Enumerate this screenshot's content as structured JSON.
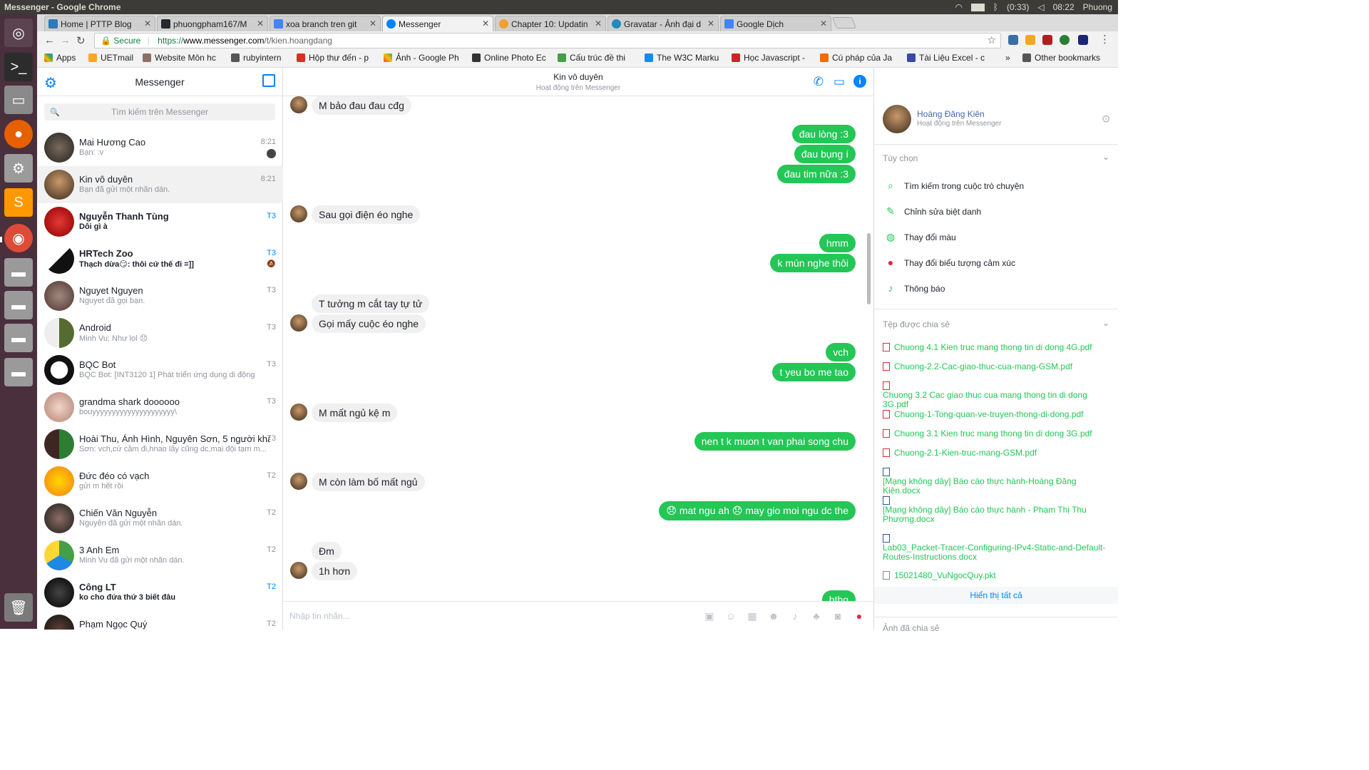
{
  "os": {
    "window_title": "Messenger - Google Chrome",
    "keyboard": "En",
    "battery": "(0:33)",
    "clock": "08:22",
    "user": "Phuong"
  },
  "browser": {
    "tabs": [
      {
        "title": "Home | PTTP Blog",
        "color": "#2b7bb9"
      },
      {
        "title": "phuongpham167/M",
        "color": "#24292e"
      },
      {
        "title": "xoa branch tren git",
        "color": "#4285f4"
      },
      {
        "title": "Messenger",
        "color": "#0084ff"
      },
      {
        "title": "Chapter 10: Updatin",
        "color": "#f0a030"
      },
      {
        "title": "Gravatar - Ảnh đại d",
        "color": "#1e8cbe"
      },
      {
        "title": "Google Dịch",
        "color": "#4285f4"
      }
    ],
    "secure_label": "Secure",
    "url_scheme": "https://",
    "url_host": "www.messenger.com",
    "url_path": "/t/kien.hoangdang",
    "bookmarks": [
      "Apps",
      "UETmail",
      "Website Môn hc",
      "rubyintern",
      "Hộp thư đến - p",
      "Ảnh - Google Ph",
      "Online Photo Ec",
      "Cấu trúc đề thi",
      "The W3C Marku",
      "Học Javascript -",
      "Cú pháp của Ja",
      "Tài Liệu Excel - c",
      "»",
      "Other bookmarks"
    ]
  },
  "messenger": {
    "title": "Messenger",
    "search_placeholder": "Tìm kiếm trên Messenger",
    "conversations": [
      {
        "name": "Mai Hương Cao",
        "preview": "Bạn: :v",
        "time": "8:21"
      },
      {
        "name": "Kin vô duyên",
        "preview": "Bạn đã gửi một nhãn dán.",
        "time": "8:21"
      },
      {
        "name": "Nguyễn Thanh Tùng",
        "preview": "Dỗi gì à",
        "time": "T3"
      },
      {
        "name": "HRTech Zoo",
        "preview": "Thạch dừa😏: thôi cứ thế đi =]]",
        "time": "T3"
      },
      {
        "name": "Nguyet Nguyen",
        "preview": "Nguyet đã gọi bạn.",
        "time": "T3"
      },
      {
        "name": "Android",
        "preview": "Minh Vu: Như lol 😞",
        "time": "T3"
      },
      {
        "name": "BQC Bot",
        "preview": "BQC Bot: [INT3120 1] Phát triển ứng dụng di động",
        "time": "T3"
      },
      {
        "name": "grandma shark doooooo",
        "preview": "bouyyyyyyyyyyyyyyyyyyyyy\\",
        "time": "T3"
      },
      {
        "name": "Hoài Thu, Ánh Hình, Nguyên Sơn, 5 người khác",
        "preview": "Sơn: vch,cứ cầm đi,hnao lấy cũng dc,mai đội tạm m...",
        "time": "T3"
      },
      {
        "name": "Đức đéo có vạch",
        "preview": "gửi m hết rồi",
        "time": "T2"
      },
      {
        "name": "Chiến Văn Nguyễn",
        "preview": "Nguyễn đã gửi một nhãn dán.",
        "time": "T2"
      },
      {
        "name": "3 Anh Em",
        "preview": "Minh Vu đã gửi một nhãn dán.",
        "time": "T2"
      },
      {
        "name": "Công LT",
        "preview": "ko cho đứa thứ 3 biết đâu",
        "time": "T2"
      },
      {
        "name": "Phạm Ngọc Quý",
        "preview": "",
        "time": "T2"
      }
    ],
    "chat": {
      "name": "Kin vô duyên",
      "status": "Hoạt động trên Messenger",
      "messages": [
        {
          "dir": "in",
          "text": "M bảo đau đau cđg"
        },
        {
          "dir": "out",
          "text": "đau lòng :3"
        },
        {
          "dir": "out",
          "text": "đau bụng í"
        },
        {
          "dir": "out",
          "text": "đau tim nữa :3"
        },
        {
          "dir": "in",
          "text": "Sau gọi điện éo nghe"
        },
        {
          "dir": "out",
          "text": "hmm"
        },
        {
          "dir": "out",
          "text": "k mún nghe thôi"
        },
        {
          "dir": "in",
          "text": "T tưởng m cắt tay tự tử"
        },
        {
          "dir": "in",
          "text": "Gọi mấy cuộc éo nghe"
        },
        {
          "dir": "out",
          "text": "vch"
        },
        {
          "dir": "out",
          "text": "t yeu bo me tao"
        },
        {
          "dir": "in",
          "text": "M mất ngủ kệ m"
        },
        {
          "dir": "out",
          "text": "nen t k muon t van phai song chu"
        },
        {
          "dir": "in",
          "text": "M còn làm bố mất ngủ"
        },
        {
          "dir": "out",
          "text": "😞 mat ngu ah 😞 may gio moi ngu dc the"
        },
        {
          "dir": "in",
          "text": "Đm"
        },
        {
          "dir": "in",
          "text": "1h hơn"
        },
        {
          "dir": "out",
          "text": "bthg"
        }
      ],
      "composer_placeholder": "Nhập tin nhắn..."
    },
    "details": {
      "name": "Hoàng Đăng Kiên",
      "status": "Hoạt động trên Messenger",
      "options_title": "Tùy chọn",
      "options": [
        {
          "label": "Tìm kiếm trong cuộc trò chuyện",
          "icon": "search-icon"
        },
        {
          "label": "Chỉnh sửa biệt danh",
          "icon": "pencil-icon"
        },
        {
          "label": "Thay đổi màu",
          "icon": "palette-icon"
        },
        {
          "label": "Thay đổi biểu tượng cảm xúc",
          "icon": "emoji-icon"
        },
        {
          "label": "Thông báo",
          "icon": "bell-icon"
        }
      ],
      "files_title": "Tệp được chia sẻ",
      "files": [
        {
          "name": "Chuong 4.1 Kien truc mang thong tin di dong 4G.pdf",
          "type": "pdf"
        },
        {
          "name": "Chuong-2.2-Cac-giao-thuc-cua-mang-GSM.pdf",
          "type": "pdf"
        },
        {
          "name": "Chuong 3.2 Cac giao thuc cua mang thong tin di dong 3G.pdf",
          "type": "pdf"
        },
        {
          "name": "Chuong-1-Tong-quan-ve-truyen-thong-di-dong.pdf",
          "type": "pdf"
        },
        {
          "name": "Chuong 3.1 Kien truc mang thong tin di dong 3G.pdf",
          "type": "pdf"
        },
        {
          "name": "Chuong-2.1-Kien-truc-mang-GSM.pdf",
          "type": "pdf"
        },
        {
          "name": "[Mạng không dây] Báo cáo thực hành-Hoàng Đăng Kiên.docx",
          "type": "doc"
        },
        {
          "name": "[Mạng không dây] Báo cáo thực hành - Phạm Thị Thu Phương.docx",
          "type": "doc"
        },
        {
          "name": "Lab03_Packet-Tracer-Configuring-IPv4-Static-and-Default-Routes-Instructions.docx",
          "type": "doc"
        },
        {
          "name": "15021480_VuNgocQuy.pkt",
          "type": "gen"
        }
      ],
      "show_all": "Hiển thị tất cả",
      "shared_photos_title": "Ảnh đã chia sẻ"
    }
  }
}
